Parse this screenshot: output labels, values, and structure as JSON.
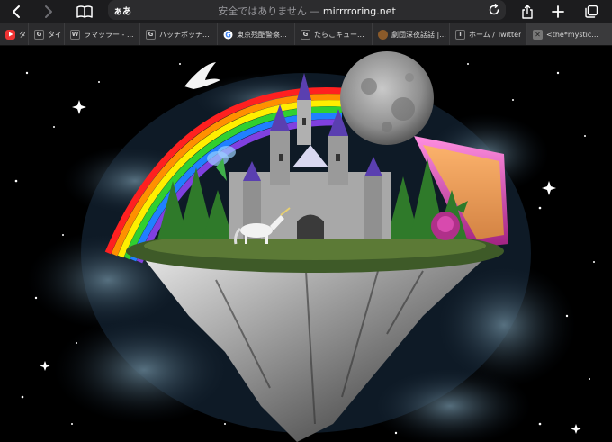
{
  "toolbar": {
    "text_size_label": "ぁあ",
    "security_warning": "安全ではありません — ",
    "host": "mirrrroring.net"
  },
  "tabs": [
    {
      "icon": "youtube-icon",
      "label": "タ"
    },
    {
      "icon": "google-g-icon",
      "label": "タイ"
    },
    {
      "icon": "wikipedia-w-icon",
      "label": "ラマッラー - ..."
    },
    {
      "icon": "google-g-icon",
      "label": "ハッチポッチ..."
    },
    {
      "icon": "google-icon",
      "label": "東京残酷警察..."
    },
    {
      "icon": "google-g-icon",
      "label": "たらこキュー..."
    },
    {
      "icon": "site-favicon",
      "label": "劇団深夜話話 |..."
    },
    {
      "icon": "twitter-t-icon",
      "label": "ホーム / Twitter"
    },
    {
      "icon": "close-icon",
      "label": "<the*mystic..."
    }
  ],
  "colors": {
    "toolbar_bg": "#1c1c1e",
    "tabbar_bg": "#2b2b2d",
    "active_tab_bg": "#3a3a3c",
    "page_bg": "#000000"
  }
}
